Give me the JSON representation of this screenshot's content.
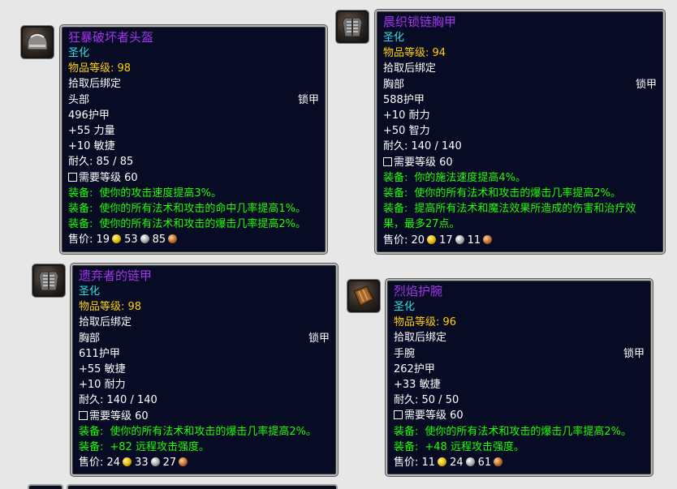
{
  "tooltips": [
    {
      "icon": "helmet-icon",
      "name": "狂暴破坏者头盔",
      "heroic": "圣化",
      "item_level": "物品等级: 98",
      "bind": "拾取后绑定",
      "slot": "头部",
      "type": "锁甲",
      "stats": [
        "496护甲",
        "+55 力量",
        "+10 敏捷"
      ],
      "durability": "耐久: 85 / 85",
      "requirement": "需要等级 60",
      "equips": [
        {
          "label": "装备:",
          "text": "使你的攻击速度提高3%。"
        },
        {
          "label": "装备:",
          "text": "使你的所有法术和攻击的命中几率提高1%。"
        },
        {
          "label": "装备:",
          "text": "使你的所有法术和攻击的爆击几率提高2%。"
        }
      ],
      "price_label": "售价:",
      "gold": "19",
      "silver": "53",
      "copper": "85"
    },
    {
      "icon": "chest-mail-icon",
      "name": "晨织锁链胸甲",
      "heroic": "圣化",
      "item_level": "物品等级: 94",
      "bind": "拾取后绑定",
      "slot": "胸部",
      "type": "锁甲",
      "stats": [
        "588护甲",
        "+10 耐力",
        "+50 智力"
      ],
      "durability": "耐久: 140 / 140",
      "requirement": "需要等级 60",
      "equips": [
        {
          "label": "装备:",
          "text": "你的施法速度提高4%。"
        },
        {
          "label": "装备:",
          "text": "使你的所有法术和攻击的爆击几率提高2%。"
        },
        {
          "label": "装备:",
          "text": "提高所有法术和魔法效果所造成的伤害和治疗效果，最多27点。"
        }
      ],
      "price_label": "售价:",
      "gold": "20",
      "silver": "17",
      "copper": "11"
    },
    {
      "icon": "chest-mail-icon",
      "name": "遗弃者的链甲",
      "heroic": "圣化",
      "item_level": "物品等级: 98",
      "bind": "拾取后绑定",
      "slot": "胸部",
      "type": "锁甲",
      "stats": [
        "611护甲",
        "+55 敏捷",
        "+10 耐力"
      ],
      "durability": "耐久: 140 / 140",
      "requirement": "需要等级 60",
      "equips": [
        {
          "label": "装备:",
          "text": "使你的所有法术和攻击的爆击几率提高2%。"
        },
        {
          "label": "装备:",
          "text": "+82 远程攻击强度。"
        }
      ],
      "price_label": "售价:",
      "gold": "24",
      "silver": "33",
      "copper": "27"
    },
    {
      "icon": "bracer-icon",
      "name": "烈焰护腕",
      "heroic": "圣化",
      "item_level": "物品等级: 96",
      "bind": "拾取后绑定",
      "slot": "手腕",
      "type": "锁甲",
      "stats": [
        "262护甲",
        "+33 敏捷"
      ],
      "durability": "耐久: 50 / 50",
      "requirement": "需要等级 60",
      "equips": [
        {
          "label": "装备:",
          "text": "使你的所有法术和攻击的爆击几率提高2%。"
        },
        {
          "label": "装备:",
          "text": "+48 远程攻击强度。"
        }
      ],
      "price_label": "售价:",
      "gold": "11",
      "silver": "24",
      "copper": "61"
    }
  ],
  "colors": {
    "epic_name": "#a335ee",
    "heroic": "#2fe0e0",
    "item_level": "#ffd100",
    "equip": "#1eff00",
    "tooltip_bg": "#070b24"
  }
}
